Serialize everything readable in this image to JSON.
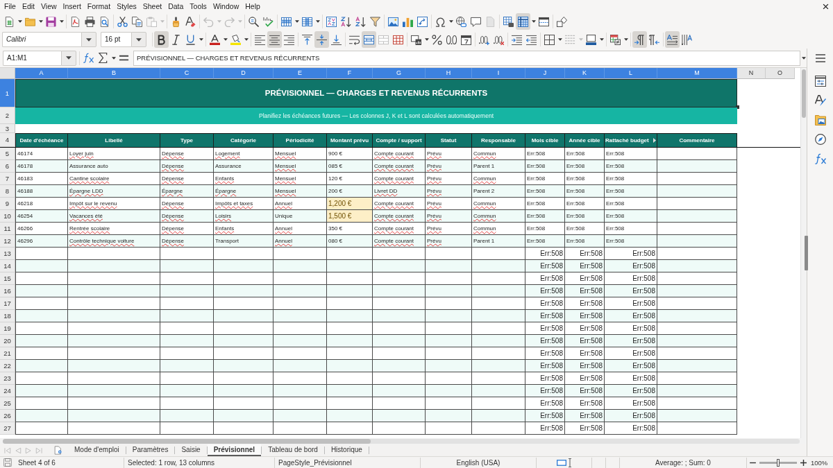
{
  "menu_bar": {
    "items": [
      "File",
      "Edit",
      "View",
      "Insert",
      "Format",
      "Styles",
      "Sheet",
      "Data",
      "Tools",
      "Window",
      "Help"
    ]
  },
  "standard_toolbar": {
    "paste_enabled": false,
    "undo_enabled": false,
    "redo_enabled": false,
    "freeze_panes": true
  },
  "formatting_toolbar": {
    "font_name": "Calibri",
    "font_size": "16 pt",
    "bold": true,
    "italic": false,
    "underline": false,
    "align_left": false,
    "align_center": true,
    "align_right": false,
    "align_top": false,
    "align_middle": true,
    "align_bottom": false,
    "merge_and_center": true,
    "merge_enabled": false,
    "border_style_enabled": false,
    "left_to_right": true,
    "right_to_left": false,
    "horizontal_text": true,
    "vertical_text": false
  },
  "formula_bar": {
    "name_box": "A1:M1",
    "content": "PRÉVISIONNEL — CHARGES ET REVENUS RÉCURRENTS"
  },
  "sheet": {
    "columns": [
      {
        "letter": "A",
        "selected": true
      },
      {
        "letter": "B",
        "selected": true
      },
      {
        "letter": "C",
        "selected": true
      },
      {
        "letter": "D",
        "selected": true
      },
      {
        "letter": "E",
        "selected": true
      },
      {
        "letter": "F",
        "selected": true
      },
      {
        "letter": "G",
        "selected": true
      },
      {
        "letter": "H",
        "selected": true
      },
      {
        "letter": "I",
        "selected": true
      },
      {
        "letter": "J",
        "selected": true
      },
      {
        "letter": "K",
        "selected": true
      },
      {
        "letter": "L",
        "selected": true
      },
      {
        "letter": "M",
        "selected": true
      },
      {
        "letter": "N",
        "selected": false
      },
      {
        "letter": "O",
        "selected": false
      }
    ],
    "rows": [
      {
        "number": "1",
        "kind": "title",
        "selected": true,
        "text": "PRÉVISIONNEL — CHARGES ET REVENUS RÉCURRENTS"
      },
      {
        "number": "2",
        "kind": "subtitle",
        "selected": false,
        "text": "Planifiez les échéances futures — Les colonnes J, K et L sont calculées automatiquement"
      },
      {
        "number": "3",
        "kind": "spacer",
        "selected": false
      },
      {
        "number": "4",
        "kind": "header",
        "selected": false,
        "cells": [
          {
            "text": "Date d'échéance",
            "clipped": false
          },
          {
            "text": "Libellé",
            "clipped": false
          },
          {
            "text": "Type",
            "clipped": false
          },
          {
            "text": "Catégorie",
            "clipped": false
          },
          {
            "text": "Périodicité",
            "clipped": false
          },
          {
            "text": "Montant prévu",
            "clipped": false
          },
          {
            "text": "Compte / support",
            "clipped": false
          },
          {
            "text": "Statut",
            "clipped": false
          },
          {
            "text": "Responsable",
            "clipped": false
          },
          {
            "text": "Mois cible",
            "clipped": false
          },
          {
            "text": "Année cible",
            "clipped": false
          },
          {
            "text": "Rattaché budget",
            "clipped": true
          },
          {
            "text": "Commentaire",
            "clipped": false
          }
        ]
      },
      {
        "number": "5",
        "kind": "entry",
        "selected": false,
        "cells": {
          "A": {
            "text": "46174",
            "misspelled": false
          },
          "B": {
            "text": "Loyer juin",
            "misspelled": true
          },
          "C": {
            "text": "Dépense",
            "misspelled": true
          },
          "D": {
            "text": "Logement",
            "misspelled": true
          },
          "E": {
            "text": "Mensuel",
            "misspelled": true
          },
          "F": {
            "text": "900 €",
            "misspelled": false,
            "highlighted": false
          },
          "G": {
            "text": "Compte courant",
            "misspelled": true
          },
          "H": {
            "text": "Prévu",
            "misspelled": true
          },
          "I": {
            "text": "Commun",
            "misspelled": true
          },
          "J": {
            "text": "Err:508",
            "misspelled": false
          },
          "K": {
            "text": "Err:508",
            "misspelled": false
          },
          "L": {
            "text": "Err:508",
            "misspelled": false
          }
        }
      },
      {
        "number": "6",
        "kind": "entry",
        "selected": false,
        "cells": {
          "A": {
            "text": "46178",
            "misspelled": false
          },
          "B": {
            "text": "Assurance auto",
            "misspelled": false
          },
          "C": {
            "text": "Dépense",
            "misspelled": true
          },
          "D": {
            "text": "Assurance",
            "misspelled": false
          },
          "E": {
            "text": "Mensuel",
            "misspelled": true
          },
          "F": {
            "text": "085 €",
            "misspelled": false,
            "highlighted": false
          },
          "G": {
            "text": "Compte courant",
            "misspelled": true
          },
          "H": {
            "text": "Prévu",
            "misspelled": true
          },
          "I": {
            "text": "Parent 1",
            "misspelled": false
          },
          "J": {
            "text": "Err:508",
            "misspelled": false
          },
          "K": {
            "text": "Err:508",
            "misspelled": false
          },
          "L": {
            "text": "Err:508",
            "misspelled": false
          }
        }
      },
      {
        "number": "7",
        "kind": "entry",
        "selected": false,
        "cells": {
          "A": {
            "text": "46183",
            "misspelled": false
          },
          "B": {
            "text": "Cantine scolaire",
            "misspelled": true
          },
          "C": {
            "text": "Dépense",
            "misspelled": true
          },
          "D": {
            "text": "Enfants",
            "misspelled": true
          },
          "E": {
            "text": "Mensuel",
            "misspelled": true
          },
          "F": {
            "text": "120 €",
            "misspelled": false,
            "highlighted": false
          },
          "G": {
            "text": "Compte courant",
            "misspelled": true
          },
          "H": {
            "text": "Prévu",
            "misspelled": true
          },
          "I": {
            "text": "Commun",
            "misspelled": true
          },
          "J": {
            "text": "Err:508",
            "misspelled": false
          },
          "K": {
            "text": "Err:508",
            "misspelled": false
          },
          "L": {
            "text": "Err:508",
            "misspelled": false
          }
        }
      },
      {
        "number": "8",
        "kind": "entry",
        "selected": false,
        "cells": {
          "A": {
            "text": "46188",
            "misspelled": false
          },
          "B": {
            "text": "Épargne LDD",
            "misspelled": true
          },
          "C": {
            "text": "Épargne",
            "misspelled": true
          },
          "D": {
            "text": "Épargne",
            "misspelled": true
          },
          "E": {
            "text": "Mensuel",
            "misspelled": true
          },
          "F": {
            "text": "200 €",
            "misspelled": false,
            "highlighted": false
          },
          "G": {
            "text": "Livret DD",
            "misspelled": true
          },
          "H": {
            "text": "Prévu",
            "misspelled": true
          },
          "I": {
            "text": "Parent 2",
            "misspelled": false
          },
          "J": {
            "text": "Err:508",
            "misspelled": false
          },
          "K": {
            "text": "Err:508",
            "misspelled": false
          },
          "L": {
            "text": "Err:508",
            "misspelled": false
          }
        }
      },
      {
        "number": "9",
        "kind": "entry",
        "selected": false,
        "cells": {
          "A": {
            "text": "46218",
            "misspelled": false
          },
          "B": {
            "text": "Impôt sur le revenu",
            "misspelled": true
          },
          "C": {
            "text": "Dépense",
            "misspelled": true
          },
          "D": {
            "text": "Impôts et taxes",
            "misspelled": true
          },
          "E": {
            "text": "Annuel",
            "misspelled": true
          },
          "F": {
            "text": "1,200 €",
            "misspelled": false,
            "highlighted": true
          },
          "G": {
            "text": "Compte courant",
            "misspelled": true
          },
          "H": {
            "text": "Prévu",
            "misspelled": true
          },
          "I": {
            "text": "Commun",
            "misspelled": true
          },
          "J": {
            "text": "Err:508",
            "misspelled": false
          },
          "K": {
            "text": "Err:508",
            "misspelled": false
          },
          "L": {
            "text": "Err:508",
            "misspelled": false
          }
        }
      },
      {
        "number": "10",
        "kind": "entry",
        "selected": false,
        "cells": {
          "A": {
            "text": "46254",
            "misspelled": false
          },
          "B": {
            "text": "Vacances été",
            "misspelled": true
          },
          "C": {
            "text": "Dépense",
            "misspelled": true
          },
          "D": {
            "text": "Loisirs",
            "misspelled": true
          },
          "E": {
            "text": "Unique",
            "misspelled": false
          },
          "F": {
            "text": "1,500 €",
            "misspelled": false,
            "highlighted": true
          },
          "G": {
            "text": "Compte courant",
            "misspelled": true
          },
          "H": {
            "text": "Prévu",
            "misspelled": true
          },
          "I": {
            "text": "Commun",
            "misspelled": true
          },
          "J": {
            "text": "Err:508",
            "misspelled": false
          },
          "K": {
            "text": "Err:508",
            "misspelled": false
          },
          "L": {
            "text": "Err:508",
            "misspelled": false
          }
        }
      },
      {
        "number": "11",
        "kind": "entry",
        "selected": false,
        "cells": {
          "A": {
            "text": "46266",
            "misspelled": false
          },
          "B": {
            "text": "Rentrée scolaire",
            "misspelled": true
          },
          "C": {
            "text": "Dépense",
            "misspelled": true
          },
          "D": {
            "text": "Enfants",
            "misspelled": true
          },
          "E": {
            "text": "Annuel",
            "misspelled": true
          },
          "F": {
            "text": "350 €",
            "misspelled": false,
            "highlighted": false
          },
          "G": {
            "text": "Compte courant",
            "misspelled": true
          },
          "H": {
            "text": "Prévu",
            "misspelled": true
          },
          "I": {
            "text": "Commun",
            "misspelled": true
          },
          "J": {
            "text": "Err:508",
            "misspelled": false
          },
          "K": {
            "text": "Err:508",
            "misspelled": false
          },
          "L": {
            "text": "Err:508",
            "misspelled": false
          }
        }
      },
      {
        "number": "12",
        "kind": "entry",
        "selected": false,
        "cells": {
          "A": {
            "text": "46296",
            "misspelled": false
          },
          "B": {
            "text": "Contrôle technique voiture",
            "misspelled": true
          },
          "C": {
            "text": "Dépense",
            "misspelled": true
          },
          "D": {
            "text": "Transport",
            "misspelled": false
          },
          "E": {
            "text": "Annuel",
            "misspelled": true
          },
          "F": {
            "text": "080 €",
            "misspelled": false,
            "highlighted": false
          },
          "G": {
            "text": "Compte courant",
            "misspelled": true
          },
          "H": {
            "text": "Prévu",
            "misspelled": true
          },
          "I": {
            "text": "Parent 1",
            "misspelled": false
          },
          "J": {
            "text": "Err:508",
            "misspelled": false
          },
          "K": {
            "text": "Err:508",
            "misspelled": false
          },
          "L": {
            "text": "Err:508",
            "misspelled": false
          }
        }
      },
      {
        "number": "13",
        "kind": "formula",
        "selected": false,
        "cells": {
          "J": {
            "text": "Err:508"
          },
          "K": {
            "text": "Err:508"
          },
          "L": {
            "text": "Err:508"
          }
        }
      },
      {
        "number": "14",
        "kind": "formula",
        "selected": false,
        "cells": {
          "J": {
            "text": "Err:508"
          },
          "K": {
            "text": "Err:508"
          },
          "L": {
            "text": "Err:508"
          }
        }
      },
      {
        "number": "15",
        "kind": "formula",
        "selected": false,
        "cells": {
          "J": {
            "text": "Err:508"
          },
          "K": {
            "text": "Err:508"
          },
          "L": {
            "text": "Err:508"
          }
        }
      },
      {
        "number": "16",
        "kind": "formula",
        "selected": false,
        "cells": {
          "J": {
            "text": "Err:508"
          },
          "K": {
            "text": "Err:508"
          },
          "L": {
            "text": "Err:508"
          }
        }
      },
      {
        "number": "17",
        "kind": "formula",
        "selected": false,
        "cells": {
          "J": {
            "text": "Err:508"
          },
          "K": {
            "text": "Err:508"
          },
          "L": {
            "text": "Err:508"
          }
        }
      },
      {
        "number": "18",
        "kind": "formula",
        "selected": false,
        "cells": {
          "J": {
            "text": "Err:508"
          },
          "K": {
            "text": "Err:508"
          },
          "L": {
            "text": "Err:508"
          }
        }
      },
      {
        "number": "19",
        "kind": "formula",
        "selected": false,
        "cells": {
          "J": {
            "text": "Err:508"
          },
          "K": {
            "text": "Err:508"
          },
          "L": {
            "text": "Err:508"
          }
        }
      },
      {
        "number": "20",
        "kind": "formula",
        "selected": false,
        "cells": {
          "J": {
            "text": "Err:508"
          },
          "K": {
            "text": "Err:508"
          },
          "L": {
            "text": "Err:508"
          }
        }
      },
      {
        "number": "21",
        "kind": "formula",
        "selected": false,
        "cells": {
          "J": {
            "text": "Err:508"
          },
          "K": {
            "text": "Err:508"
          },
          "L": {
            "text": "Err:508"
          }
        }
      },
      {
        "number": "22",
        "kind": "formula",
        "selected": false,
        "cells": {
          "J": {
            "text": "Err:508"
          },
          "K": {
            "text": "Err:508"
          },
          "L": {
            "text": "Err:508"
          }
        }
      },
      {
        "number": "23",
        "kind": "formula",
        "selected": false,
        "cells": {
          "J": {
            "text": "Err:508"
          },
          "K": {
            "text": "Err:508"
          },
          "L": {
            "text": "Err:508"
          }
        }
      },
      {
        "number": "24",
        "kind": "formula",
        "selected": false,
        "cells": {
          "J": {
            "text": "Err:508"
          },
          "K": {
            "text": "Err:508"
          },
          "L": {
            "text": "Err:508"
          }
        }
      },
      {
        "number": "25",
        "kind": "formula",
        "selected": false,
        "cells": {
          "J": {
            "text": "Err:508"
          },
          "K": {
            "text": "Err:508"
          },
          "L": {
            "text": "Err:508"
          }
        }
      },
      {
        "number": "26",
        "kind": "formula",
        "selected": false,
        "cells": {
          "J": {
            "text": "Err:508"
          },
          "K": {
            "text": "Err:508"
          },
          "L": {
            "text": "Err:508"
          }
        }
      },
      {
        "number": "27",
        "kind": "formula",
        "selected": false,
        "cells": {
          "J": {
            "text": "Err:508"
          },
          "K": {
            "text": "Err:508"
          },
          "L": {
            "text": "Err:508"
          }
        }
      }
    ]
  },
  "sheet_tabs": {
    "tabs": [
      {
        "label": "Mode d'emploi",
        "selected": false
      },
      {
        "label": "Paramètres",
        "selected": false
      },
      {
        "label": "Saisie",
        "selected": false
      },
      {
        "label": "Prévisionnel",
        "selected": true
      },
      {
        "label": "Tableau de bord",
        "selected": false
      },
      {
        "label": "Historique",
        "selected": false
      }
    ]
  },
  "status_bar": {
    "sheet": "Sheet 4 of 6",
    "selection": "Selected: 1 row, 13 columns",
    "page_style": "PageStyle_Prévisionnel",
    "language": "English (USA)",
    "summary": "Average: ; Sum: 0",
    "zoom": {
      "level": 0.5,
      "reading": "100%"
    }
  }
}
